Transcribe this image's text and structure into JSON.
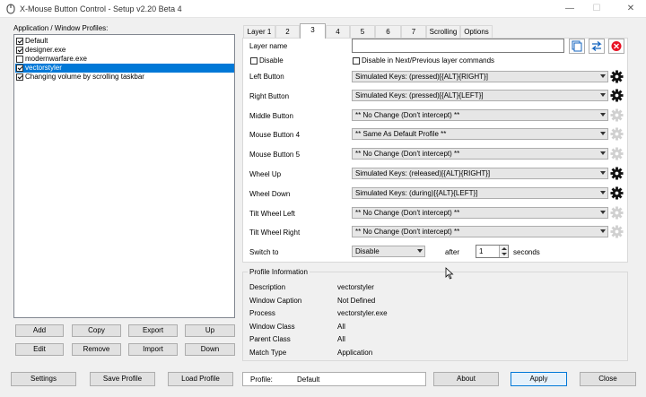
{
  "window": {
    "title": "X-Mouse Button Control - Setup v2.20 Beta 4",
    "minimize": "—",
    "maximize": "☐",
    "close": "✕"
  },
  "profiles": {
    "label": "Application / Window Profiles:",
    "items": [
      {
        "label": "Default",
        "checked": true
      },
      {
        "label": "designer.exe",
        "checked": true
      },
      {
        "label": "modernwarfare.exe",
        "checked": false
      },
      {
        "label": "vectorstyler",
        "checked": true,
        "selected": true
      },
      {
        "label": "Changing volume by scrolling taskbar",
        "checked": true
      }
    ]
  },
  "left_buttons": {
    "add": "Add",
    "copy": "Copy",
    "export": "Export",
    "up": "Up",
    "edit": "Edit",
    "remove": "Remove",
    "import": "Import",
    "down": "Down"
  },
  "tabs": [
    "Layer 1",
    "2",
    "3",
    "4",
    "5",
    "6",
    "7",
    "Scrolling",
    "Options"
  ],
  "active_tab": "3",
  "layer": {
    "name_label": "Layer name",
    "name_value": "",
    "disable_label": "Disable",
    "disable_next_prev_label": "Disable in Next/Previous layer commands"
  },
  "rows": [
    {
      "label": "Left Button",
      "value": "Simulated Keys: (pressed)[{ALT}{RIGHT}]",
      "gear_enabled": true
    },
    {
      "label": "Right Button",
      "value": "Simulated Keys: (pressed)[{ALT}{LEFT}]",
      "gear_enabled": true
    },
    {
      "label": "Middle Button",
      "value": "** No Change (Don't intercept) **",
      "gear_enabled": false
    },
    {
      "label": "Mouse Button 4",
      "value": "** Same As Default Profile **",
      "gear_enabled": false
    },
    {
      "label": "Mouse Button 5",
      "value": "** No Change (Don't intercept) **",
      "gear_enabled": false
    },
    {
      "label": "Wheel Up",
      "value": "Simulated Keys: (released)[{ALT}{RIGHT}]",
      "gear_enabled": true
    },
    {
      "label": "Wheel Down",
      "value": "Simulated Keys: (during)[{ALT}{LEFT}]",
      "gear_enabled": true
    },
    {
      "label": "Tilt Wheel Left",
      "value": "** No Change (Don't intercept) **",
      "gear_enabled": false
    },
    {
      "label": "Tilt Wheel Right",
      "value": "** No Change (Don't intercept) **",
      "gear_enabled": false
    }
  ],
  "switch": {
    "label": "Switch to",
    "value": "Disable",
    "after": "after",
    "seconds_value": "1",
    "seconds": "seconds"
  },
  "profile_info": {
    "title": "Profile Information",
    "fields": [
      {
        "key": "Description",
        "value": "vectorstyler"
      },
      {
        "key": "Window Caption",
        "value": "Not Defined"
      },
      {
        "key": "Process",
        "value": "vectorstyler.exe"
      },
      {
        "key": "Window Class",
        "value": "All"
      },
      {
        "key": "Parent Class",
        "value": "All"
      },
      {
        "key": "Match Type",
        "value": "Application"
      }
    ]
  },
  "bottom": {
    "settings": "Settings",
    "save_profile": "Save Profile",
    "load_profile": "Load Profile",
    "profile_label": "Profile:",
    "profile_value": "Default",
    "about": "About",
    "apply": "Apply",
    "close": "Close"
  },
  "colors": {
    "selection": "#0078d7",
    "apply_border": "#0078d7",
    "red_icon": "#e81123",
    "blue_icon": "#1565c0"
  },
  "icons": {
    "copy_layer": "copy-layer-icon",
    "swap_layers": "swap-icon",
    "clear_layer": "clear-icon",
    "gear": "gear-icon"
  }
}
